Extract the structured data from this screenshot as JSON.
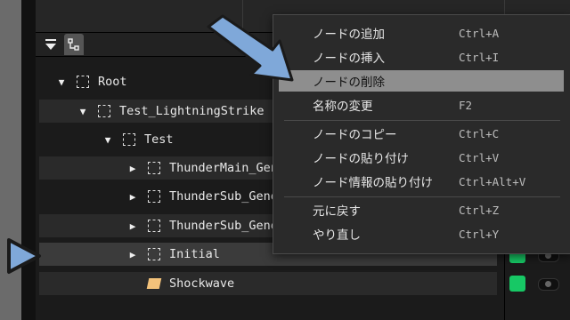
{
  "tree": {
    "rows": [
      {
        "label": "Root",
        "expanded": true
      },
      {
        "label": "Test_LightningStrike",
        "expanded": true
      },
      {
        "label": "Test",
        "expanded": true
      },
      {
        "label": "ThunderMain_Generator",
        "expanded": false
      },
      {
        "label": "ThunderSub_Generator",
        "expanded": false
      },
      {
        "label": "ThunderSub_Generator",
        "expanded": false
      },
      {
        "label": "Initial",
        "expanded": false
      },
      {
        "label": "Shockwave",
        "expanded": false
      }
    ]
  },
  "context_menu": {
    "items": [
      {
        "label": "ノードの追加",
        "shortcut": "Ctrl+A"
      },
      {
        "label": "ノードの挿入",
        "shortcut": "Ctrl+I"
      },
      {
        "label": "ノードの削除",
        "shortcut": ""
      },
      {
        "label": "名称の変更",
        "shortcut": "F2"
      },
      {
        "label": "ノードのコピー",
        "shortcut": "Ctrl+C"
      },
      {
        "label": "ノードの貼り付け",
        "shortcut": "Ctrl+V"
      },
      {
        "label": "ノード情報の貼り付け",
        "shortcut": "Ctrl+Alt+V"
      },
      {
        "label": "元に戻す",
        "shortcut": "Ctrl+Z"
      },
      {
        "label": "やり直し",
        "shortcut": "Ctrl+Y"
      }
    ],
    "highlighted_index": 2
  },
  "colors": {
    "accent_annotation": "#7fa8d9",
    "visibility_on": "#17c865",
    "leaf_icon": "#f3c27a"
  }
}
